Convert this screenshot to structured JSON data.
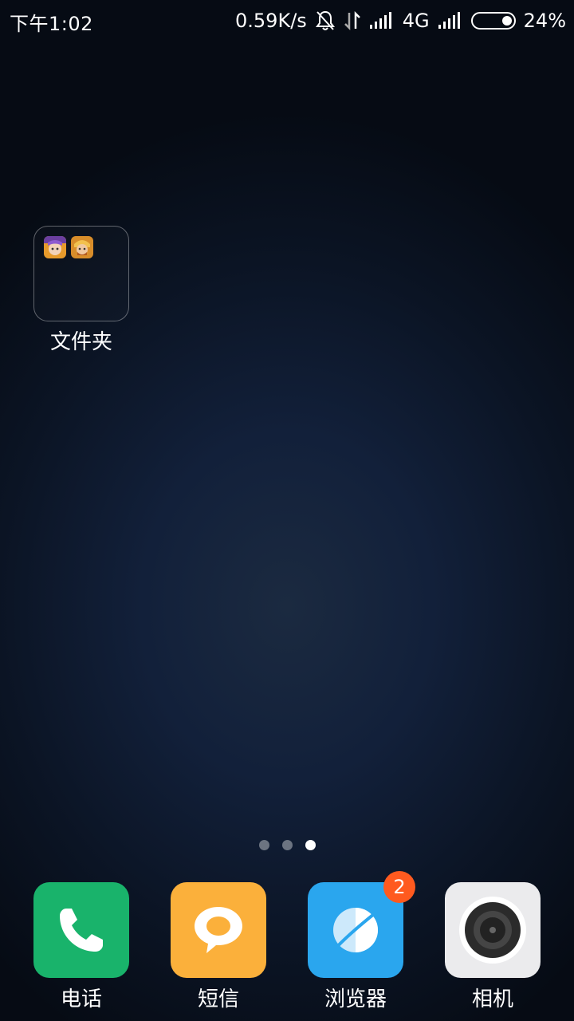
{
  "status_bar": {
    "time": "下午1:02",
    "net_speed": "0.59K/s",
    "network_type": "4G",
    "battery": "24%",
    "battery_level": 0.24,
    "icons": [
      "mute-bell-icon",
      "data-transfer-icon",
      "signal-icon",
      "signal-icon"
    ]
  },
  "folder": {
    "label": "文件夹",
    "apps": [
      "game-icon-1",
      "game-icon-2"
    ]
  },
  "page_indicator": {
    "count": 3,
    "active_index": 2
  },
  "dock": {
    "apps": [
      {
        "label": "电话",
        "icon": "phone-icon",
        "color": "#19b36b"
      },
      {
        "label": "短信",
        "icon": "message-icon",
        "color": "#fbb03b"
      },
      {
        "label": "浏览器",
        "icon": "browser-icon",
        "color": "#2aa6ee",
        "badge": "2"
      },
      {
        "label": "相机",
        "icon": "camera-icon",
        "color": "#ebebed"
      }
    ]
  },
  "colors": {
    "badge": "#ff5a1f",
    "wallpaper_center": "#1b2a40",
    "wallpaper_edge": "#060b14"
  }
}
